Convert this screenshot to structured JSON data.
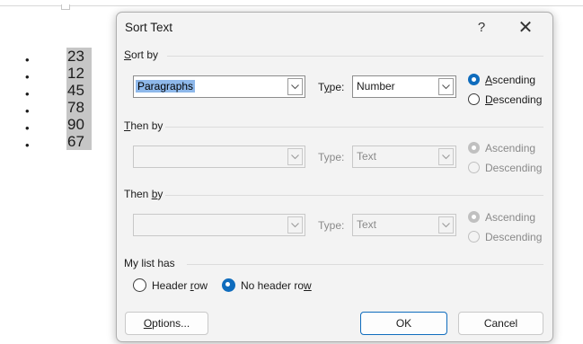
{
  "document": {
    "list_items": [
      "23",
      "12",
      "45",
      "78",
      "90",
      "67"
    ],
    "bullet_char": "•"
  },
  "dialog": {
    "title": "Sort Text",
    "help": "?",
    "close": "✕",
    "sort_by": {
      "label_prefix": "",
      "label_key": "S",
      "label_rest": "ort by",
      "field_value": "Paragraphs",
      "type_label_pre": "T",
      "type_label_key": "y",
      "type_label_post": "pe:",
      "type_value": "Number",
      "ascending_key": "A",
      "ascending_rest": "scending",
      "descending_key": "D",
      "descending_rest": "escending",
      "order": "ascending"
    },
    "then_by_1": {
      "label_key": "T",
      "label_rest": "hen by",
      "field_value": "",
      "type_label": "Type:",
      "type_value": "Text",
      "ascending_label": "Ascending",
      "descending_label": "Descending",
      "order": "ascending",
      "enabled": false
    },
    "then_by_2": {
      "label_pre": "Then ",
      "label_key": "b",
      "label_post": "y",
      "field_value": "",
      "type_label": "Type:",
      "type_value": "Text",
      "ascending_label": "Ascending",
      "descending_label": "Descending",
      "order": "ascending",
      "enabled": false
    },
    "list_has": {
      "label": "My list has",
      "header_row_pre": "Header ",
      "header_row_key": "r",
      "header_row_post": "ow",
      "no_header_row_pre": "No header ro",
      "no_header_row_key": "w",
      "selected": "no_header_row"
    },
    "buttons": {
      "options_key": "O",
      "options_rest": "ptions...",
      "ok": "OK",
      "cancel": "Cancel"
    },
    "colors": {
      "accent": "#0f6cbd",
      "selection": "#8eb8ea",
      "list_highlight": "#c6c6c6"
    }
  }
}
